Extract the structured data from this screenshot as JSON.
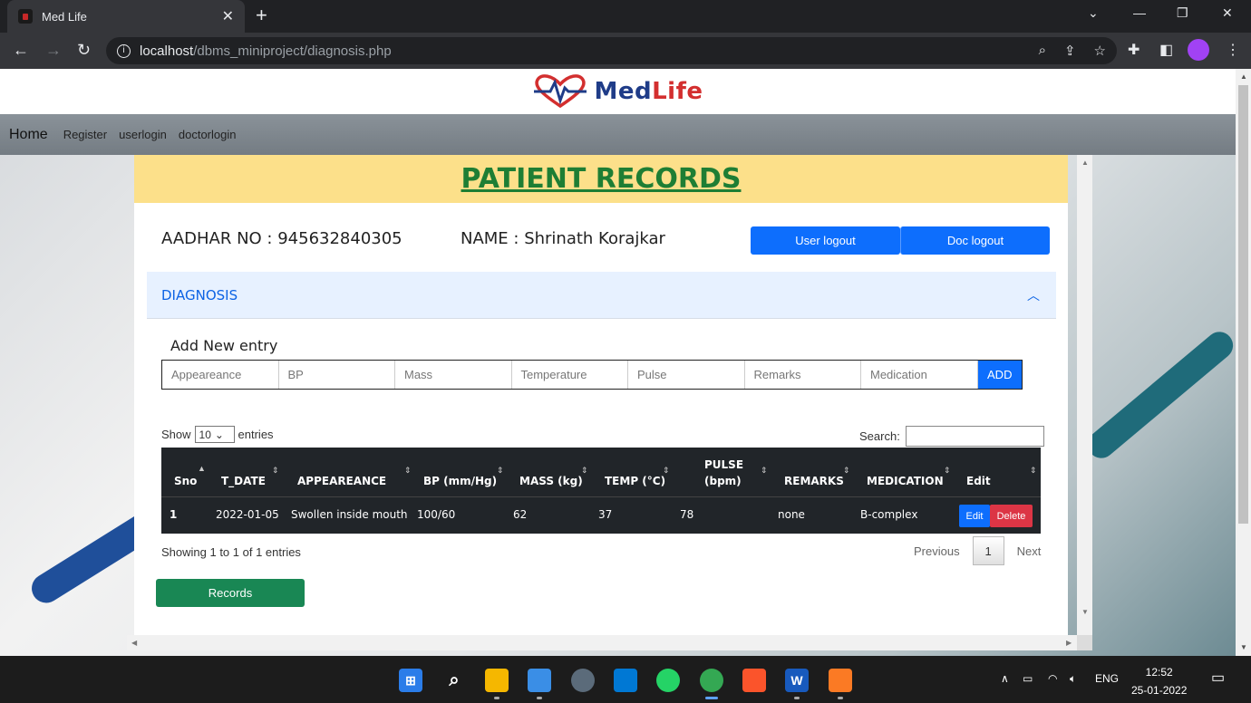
{
  "browser": {
    "tab_title": "Med Life",
    "url_host": "localhost",
    "url_path": "/dbms_miniproject/diagnosis.php"
  },
  "logo": {
    "part1": "Med",
    "part2": "Life"
  },
  "nav": {
    "brand": "Home",
    "links": [
      "Register",
      "userlogin",
      "doctorlogin"
    ]
  },
  "header": {
    "title": "PATIENT RECORDS"
  },
  "patient": {
    "aadhar": "AADHAR NO : 945632840305",
    "name": "NAME : Shrinath Korajkar"
  },
  "buttons": {
    "user_logout": "User logout",
    "doc_logout": "Doc logout",
    "add": "ADD",
    "records": "Records"
  },
  "accordion": {
    "title": "DIAGNOSIS"
  },
  "form": {
    "title": "Add New entry",
    "placeholders": [
      "Appeareance",
      "BP",
      "Mass",
      "Temperature",
      "Pulse",
      "Remarks",
      "Medication"
    ]
  },
  "table_controls": {
    "show_prefix": "Show",
    "entries_value": "10",
    "show_suffix": "entries",
    "search_label": "Search:",
    "info": "Showing 1 to 1 of 1 entries",
    "prev": "Previous",
    "page": "1",
    "next": "Next"
  },
  "table": {
    "headers": [
      "Sno",
      "T_DATE",
      "APPEAREANCE",
      "BP (mm/Hg)",
      "MASS (kg)",
      "TEMP (°C)",
      "PULSE",
      "(bpm)",
      "REMARKS",
      "MEDICATION",
      "Edit"
    ],
    "rows": [
      {
        "sno": "1",
        "date": "2022-01-05",
        "appearance": "Swollen inside mouth",
        "bp": "100/60",
        "mass": "62",
        "temp": "37",
        "pulse": "78",
        "remarks": "none",
        "medication": "B-complex",
        "edit": "Edit",
        "delete": "Delete"
      }
    ]
  },
  "taskbar": {
    "lang": "ENG",
    "time": "12:52",
    "date": "25-01-2022"
  },
  "colors": {
    "header_band": "#fce08a",
    "title_green": "#1e7e34",
    "primary": "#0d6efd",
    "danger": "#dc3545",
    "success": "#198754"
  }
}
